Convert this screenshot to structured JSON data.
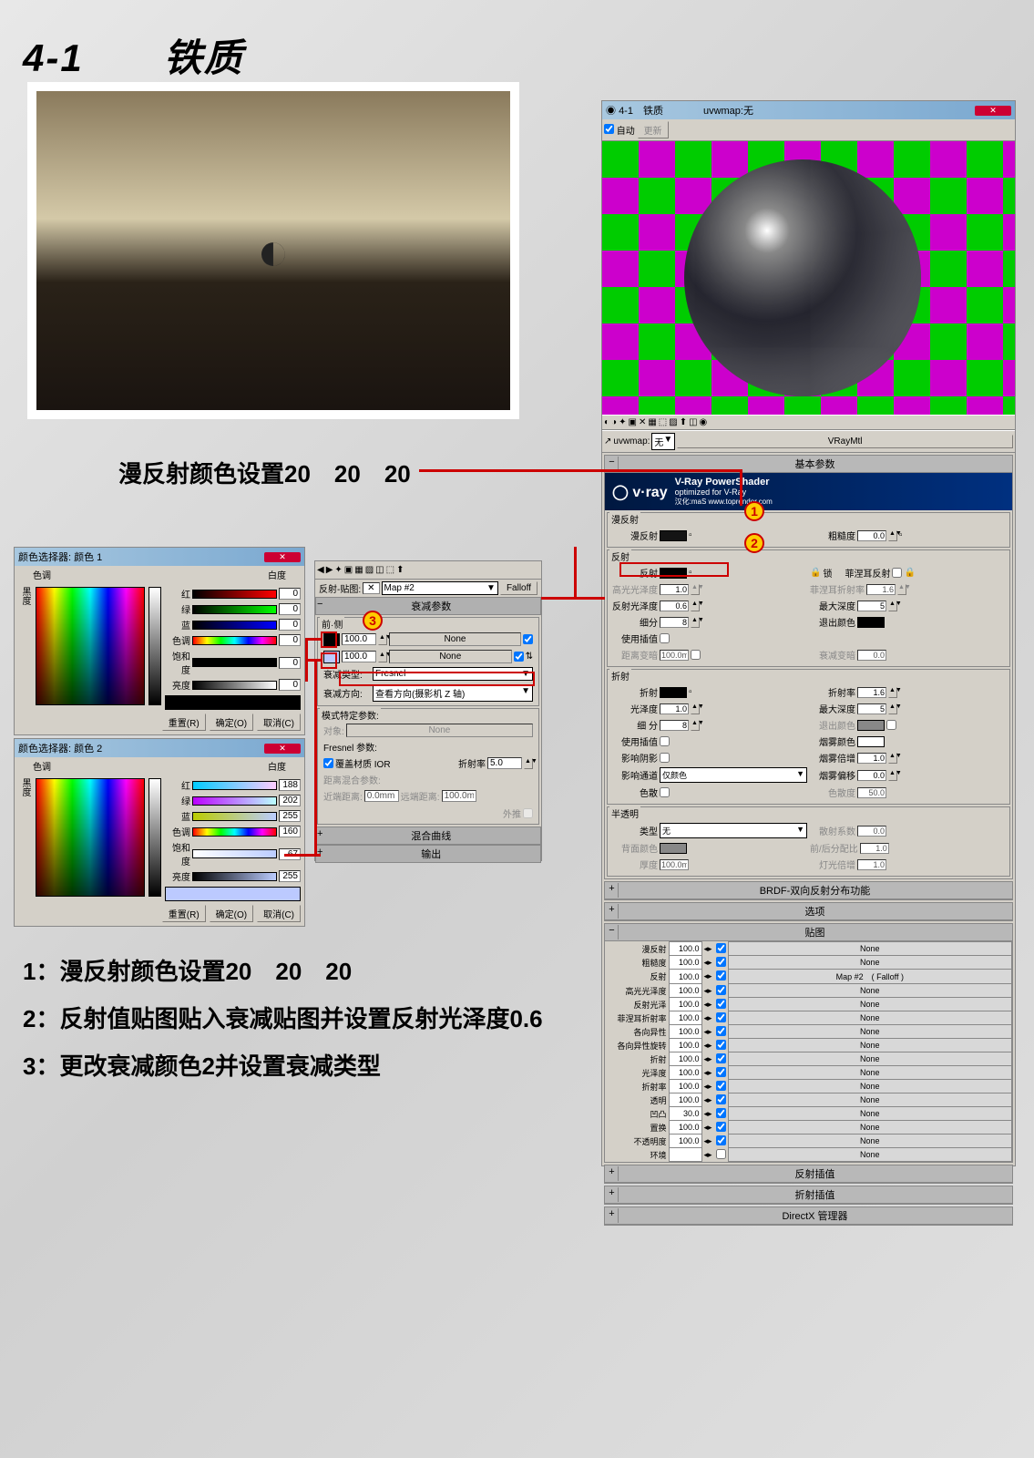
{
  "page": {
    "title": "4-1　　铁质",
    "instruction1": "漫反射颜色设置20　20　20",
    "steps": [
      "1：漫反射颜色设置20　20　20",
      "2：反射值贴图贴入衰减贴图并设置反射光泽度0.6",
      "3：更改衰减颜色2并设置衰减类型"
    ]
  },
  "colorPicker1": {
    "title": "颜色选择器: 颜色 1",
    "hueLabel": "色调",
    "whiteLabel": "白度",
    "blackLabel": "黑度",
    "rgb": {
      "r_lbl": "红",
      "g_lbl": "绿",
      "b_lbl": "蓝",
      "r": "0",
      "g": "0",
      "b": "0"
    },
    "hsv": {
      "h_lbl": "色调",
      "s_lbl": "饱和度",
      "v_lbl": "亮度",
      "h": "0",
      "s": "0",
      "v": "0"
    },
    "reset": "重置(R)",
    "ok": "确定(O)",
    "cancel": "取消(C)"
  },
  "colorPicker2": {
    "title": "颜色选择器: 颜色 2",
    "rgb": {
      "r": "188",
      "g": "202",
      "b": "255"
    },
    "hsv": {
      "h": "160",
      "s": "67",
      "v": "255"
    }
  },
  "falloff": {
    "mapRowLabel": "反射-贴图:",
    "mapName": "Map #2",
    "mapType": "Falloff",
    "section": "衰减参数",
    "frontSide": "前·侧",
    "val1": "100.0",
    "slot1": "None",
    "val2": "100.0",
    "slot2": "None",
    "typeLabel": "衰减类型:",
    "typeValue": "Fresnel",
    "dirLabel": "衰减方向:",
    "dirValue": "查看方向(摄影机 Z 轴)",
    "modeSection": "模式特定参数:",
    "objLabel": "对象:",
    "objValue": "None",
    "fresnelLabel": "Fresnel 参数:",
    "overrideIOR": "覆盖材质 IOR",
    "iorLabel": "折射率",
    "iorValue": "5.0",
    "distLabel": "距离混合参数:",
    "nearLabel": "近端距离:",
    "nearVal": "0.0mm",
    "farLabel": "远端距离:",
    "farVal": "100.0m",
    "extrap": "外推",
    "mixCurve": "混合曲线",
    "output": "输出"
  },
  "matEditor": {
    "winTitle": "4-1　铁质　　　　uvwmap:无",
    "autoUpdate": "自动",
    "update": "更新",
    "slotRow": {
      "uvw": "uvwmap:",
      "none": "无",
      "mtl": "VRayMtl"
    },
    "basicParams": "基本参数",
    "vray": {
      "title": "V-Ray PowerShader",
      "sub": "optimized for V-Ray",
      "credit": "汉化:maS www.toprender.com"
    },
    "diffuse": {
      "group": "漫反射",
      "label": "漫反射",
      "roughLabel": "粗糙度",
      "roughVal": "0.0"
    },
    "reflect": {
      "group": "反射",
      "label": "反射",
      "lock": "锁",
      "fresnelLabel": "菲涅耳反射",
      "hiliteLabel": "高光光泽度",
      "hiliteVal": "1.0",
      "reflGlossLabel": "反射光泽度",
      "reflGlossVal": "0.6",
      "fresnelIORLabel": "菲涅耳折射率",
      "fresnelIORVal": "1.6",
      "subdivLabel": "细分",
      "subdivVal": "8",
      "maxDepthLabel": "最大深度",
      "maxDepthVal": "5",
      "interpLabel": "使用插值",
      "exitColorLabel": "退出颜色",
      "dimDistLabel": "距离变暗",
      "dimDistVal": "100.0m",
      "dimFalloffLabel": "衰减变暗",
      "dimFalloffVal": "0.0"
    },
    "refract": {
      "group": "折射",
      "label": "折射",
      "iorLabel": "折射率",
      "iorVal": "1.6",
      "glossLabel": "光泽度",
      "glossVal": "1.0",
      "maxDepthLabel": "最大深度",
      "maxDepthVal": "5",
      "subdivLabel": "细 分",
      "subdivVal": "8",
      "exitColorLabel": "退出颜色",
      "interpLabel": "使用插值",
      "fogColorLabel": "烟雾颜色",
      "shadowLabel": "影响阴影",
      "fogMultLabel": "烟雾倍增",
      "fogMultVal": "1.0",
      "affectChanLabel": "影响通道",
      "affectChanVal": "仅颜色",
      "fogBiasLabel": "烟雾偏移",
      "fogBiasVal": "0.0",
      "dispLabel": "色散",
      "dispAbbeLabel": "色散度",
      "dispAbbeVal": "50.0"
    },
    "translucency": {
      "group": "半透明",
      "typeLabel": "类型",
      "typeVal": "无",
      "scatterLabel": "散射系数",
      "scatterVal": "0.0",
      "backColorLabel": "背面颜色",
      "fbLabel": "前/后分配比",
      "fbVal": "1.0",
      "thickLabel": "厚度",
      "thickVal": "100.0m",
      "lightMultLabel": "灯光倍增",
      "lightMultVal": "1.0"
    },
    "brdf": "BRDF-双向反射分布功能",
    "options": "选项",
    "maps": {
      "title": "贴图",
      "rows": [
        {
          "name": "漫反射",
          "val": "100.0",
          "slot": "None"
        },
        {
          "name": "粗糙度",
          "val": "100.0",
          "slot": "None"
        },
        {
          "name": "反射",
          "val": "100.0",
          "slot": "Map #2　( Falloff )"
        },
        {
          "name": "高光光泽度",
          "val": "100.0",
          "slot": "None"
        },
        {
          "name": "反射光泽",
          "val": "100.0",
          "slot": "None"
        },
        {
          "name": "菲涅耳折射率",
          "val": "100.0",
          "slot": "None"
        },
        {
          "name": "各向异性",
          "val": "100.0",
          "slot": "None"
        },
        {
          "name": "各向异性旋转",
          "val": "100.0",
          "slot": "None"
        },
        {
          "name": "折射",
          "val": "100.0",
          "slot": "None"
        },
        {
          "name": "光泽度",
          "val": "100.0",
          "slot": "None"
        },
        {
          "name": "折射率",
          "val": "100.0",
          "slot": "None"
        },
        {
          "name": "透明",
          "val": "100.0",
          "slot": "None"
        },
        {
          "name": "凹凸",
          "val": "30.0",
          "slot": "None"
        },
        {
          "name": "置换",
          "val": "100.0",
          "slot": "None"
        },
        {
          "name": "不透明度",
          "val": "100.0",
          "slot": "None"
        },
        {
          "name": "环境",
          "val": "",
          "slot": "None"
        }
      ]
    },
    "reflInterp": "反射插值",
    "refrInterp": "折射插值",
    "directx": "DirectX 管理器"
  }
}
